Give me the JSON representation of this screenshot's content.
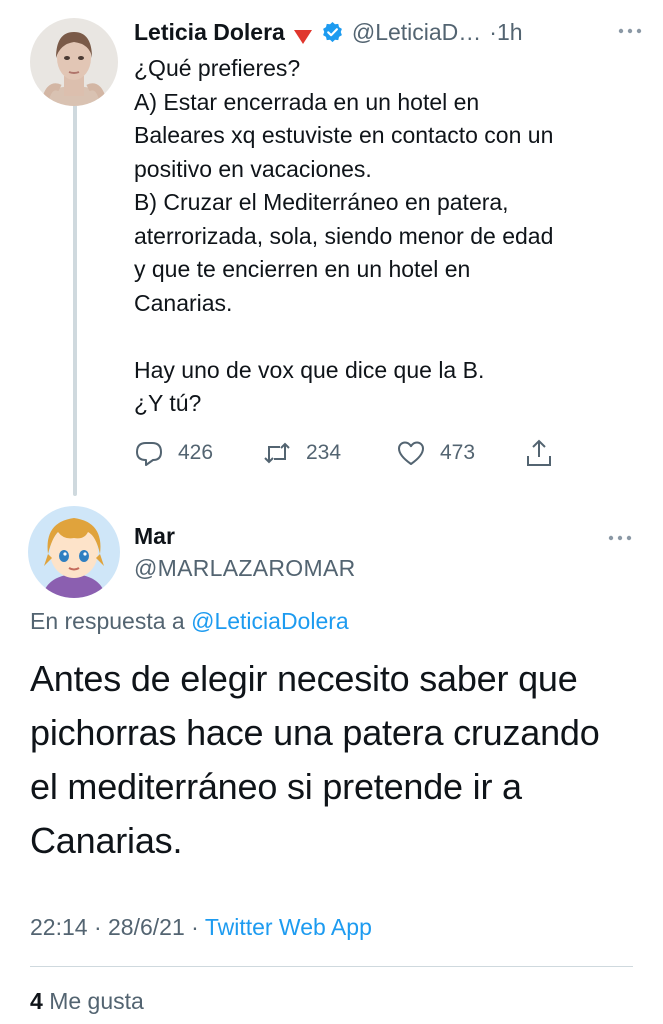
{
  "parent_tweet": {
    "author_name": "Leticia Dolera",
    "author_handle": "@LeticiaD…",
    "time": "1h",
    "separator": "·",
    "lines": [
      "¿Qué prefieres?",
      "A) Estar encerrada en un hotel en",
      "Baleares xq estuviste en contacto con un",
      "positivo en vacaciones.",
      "B) Cruzar el Mediterráneo en patera,",
      "aterrorizada, sola, siendo menor de edad",
      "y que te encierren en un hotel en",
      "Canarias.",
      "",
      "Hay uno de vox que dice que la B.",
      "¿Y tú?"
    ],
    "replies": "426",
    "retweets": "234",
    "likes": "473",
    "icons": {
      "flag": "red-down-triangle-icon",
      "verified": "verified-badge-icon",
      "more": "more-dots-icon",
      "reply": "reply-bubble-icon",
      "retweet": "retweet-icon",
      "like": "heart-icon",
      "share": "share-icon"
    }
  },
  "reply_tweet": {
    "author_name": "Mar",
    "author_handle": "@MARLAZAROMAR",
    "reply_prefix": "En respuesta a",
    "reply_mention": "@LeticiaDolera",
    "lines": [
      "Antes de elegir necesito saber que",
      "pichorras hace una patera cruzando",
      "el mediterráneo si pretende ir a",
      "Canarias."
    ],
    "time": "22:14",
    "date": "28/6/21",
    "separator": "·",
    "source": "Twitter Web App",
    "like_count": "4",
    "like_label": "Me gusta"
  },
  "colors": {
    "text": "#0f1419",
    "secondary": "#536471",
    "link": "#1d9bf0",
    "thread_line": "#cfd9de"
  }
}
